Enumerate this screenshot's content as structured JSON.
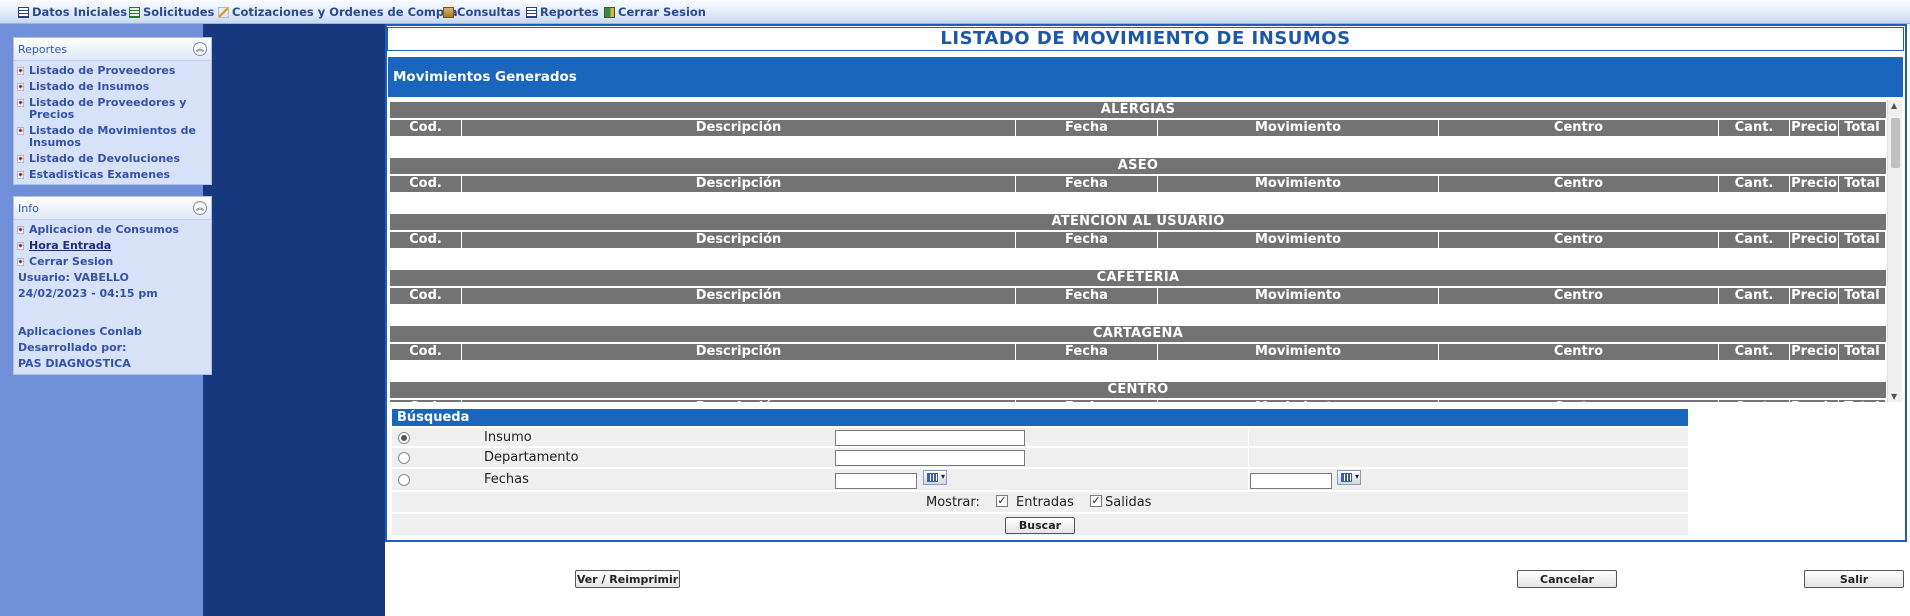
{
  "menu": [
    {
      "label": "Datos Iniciales",
      "icon": "table-icon"
    },
    {
      "label": "Solicitudes",
      "icon": "sheet-icon"
    },
    {
      "label": "Cotizaciones y Ordenes de Compra",
      "icon": "pencil-icon"
    },
    {
      "label": "Consultas",
      "icon": "box-icon"
    },
    {
      "label": "Reportes",
      "icon": "table-icon"
    },
    {
      "label": "Cerrar Sesion",
      "icon": "door-icon"
    }
  ],
  "sidebar": {
    "reportes": {
      "title": "Reportes",
      "items": [
        "Listado de Proveedores",
        "Listado de Insumos",
        "Listado de Proveedores y Precios",
        "Listado de Movimientos de Insumos",
        "Listado de Devoluciones",
        "Estadisticas Examenes"
      ]
    },
    "info": {
      "title": "Info",
      "items": [
        "Aplicacion de Consumos",
        "Hora Entrada",
        "Cerrar Sesion"
      ],
      "user": "Usuario: VABELLO",
      "datetime": "24/02/2023 - 04:15 pm",
      "app": "Aplicaciones Conlab",
      "dev_label": "Desarrollado por:",
      "dev_name": "PAS DIAGNOSTICA"
    }
  },
  "page_title": "LISTADO DE MOVIMIENTO DE INSUMOS",
  "section_title": "Movimientos Generados",
  "columns": [
    "Cod.",
    "Descripción",
    "Fecha",
    "Movimiento",
    "Centro",
    "Cant.",
    "Precio",
    "Total"
  ],
  "groups": [
    "ALERGIAS",
    "ASEO",
    "ATENCION AL USUARIO",
    "CAFETERIA",
    "CARTAGENA",
    "CENTRO"
  ],
  "search": {
    "title": "Búsqueda",
    "options": [
      "Insumo",
      "Departamento",
      "Fechas"
    ],
    "selected": "Insumo",
    "insumo_value": "",
    "departamento_value": "",
    "fecha_desde": "",
    "fecha_hasta": "",
    "mostrar_label": "Mostrar:",
    "entradas_label": "Entradas",
    "salidas_label": "Salidas",
    "entradas_checked": true,
    "salidas_checked": true,
    "buscar_label": "Buscar"
  },
  "buttons": {
    "ver": "Ver / Reimprimir",
    "cancelar": "Cancelar",
    "salir": "Salir"
  },
  "colors": {
    "accent_blue": "#1a66bd",
    "sidebar_dark": "#17387e",
    "sidebar_light": "#6f8fd9",
    "group_gray": "#737373"
  }
}
